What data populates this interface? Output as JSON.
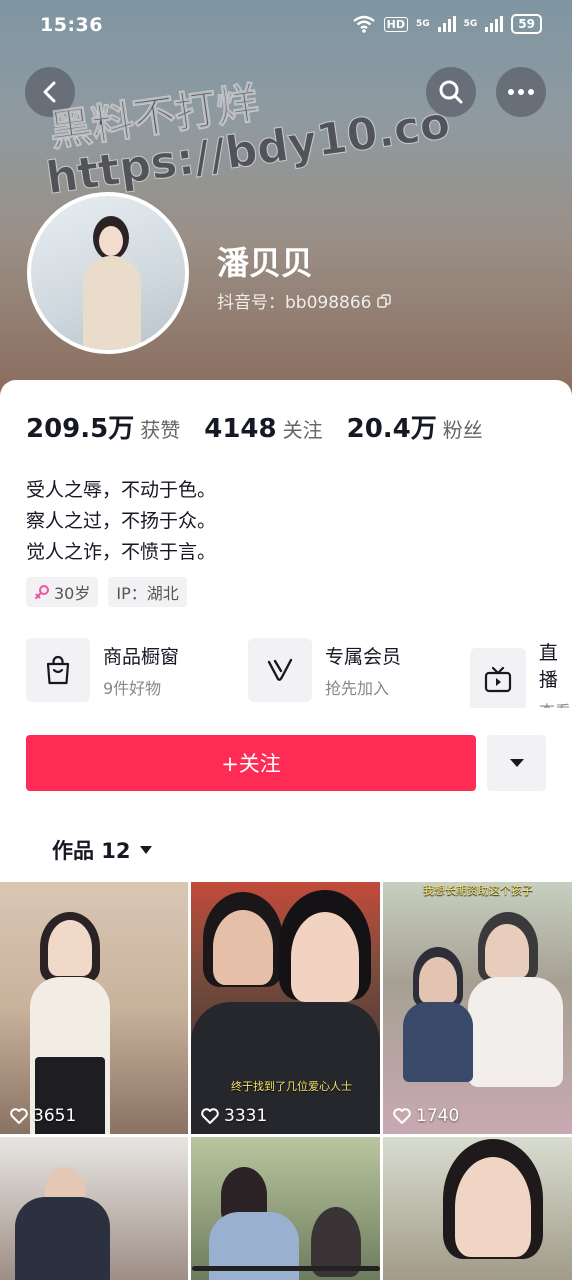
{
  "status_bar": {
    "time": "15:36",
    "network_hd": "HD",
    "signal_1": "5G",
    "signal_2": "5G",
    "battery": "59"
  },
  "header": {
    "back_icon": "chevron-left-icon",
    "search_icon": "search-icon",
    "more_icon": "more-icon"
  },
  "watermark": {
    "line1": "黑料不打烊",
    "line2": "https://bdy10.co"
  },
  "profile": {
    "name": "潘贝贝",
    "douyin_id": "抖音号：bb098866",
    "copy_icon": "copy-icon"
  },
  "stats": [
    {
      "value": "209.5万",
      "label": "获赞"
    },
    {
      "value": "4148",
      "label": "关注"
    },
    {
      "value": "20.4万",
      "label": "粉丝"
    }
  ],
  "bio": {
    "line1": "受人之辱，不动于色。",
    "line2": "察人之过，不扬于众。",
    "line3": "觉人之诈，不愤于言。"
  },
  "tags": {
    "age": "30岁",
    "ip": "IP：湖北"
  },
  "services": [
    {
      "icon": "shopping-bag-icon",
      "title": "商品橱窗",
      "subtitle": "9件好物"
    },
    {
      "icon": "member-v-icon",
      "title": "专属会员",
      "subtitle": "抢先加入"
    },
    {
      "icon": "tv-icon",
      "title": "直播",
      "subtitle": "查看"
    }
  ],
  "actions": {
    "follow_label": "+关注",
    "dropdown_icon": "triangle-down-icon"
  },
  "works_tab": {
    "label": "作品 12"
  },
  "videos": [
    {
      "likes": "3651"
    },
    {
      "likes": "3331",
      "caption": "终于找到了几位爱心人士"
    },
    {
      "likes": "1740",
      "caption": "我想长期资助这个孩子"
    },
    {
      "likes": ""
    },
    {
      "likes": ""
    },
    {
      "likes": ""
    }
  ],
  "colors": {
    "primary_red": "#fe2c55",
    "text_main": "#161823",
    "gender_pink": "#f052a6"
  }
}
